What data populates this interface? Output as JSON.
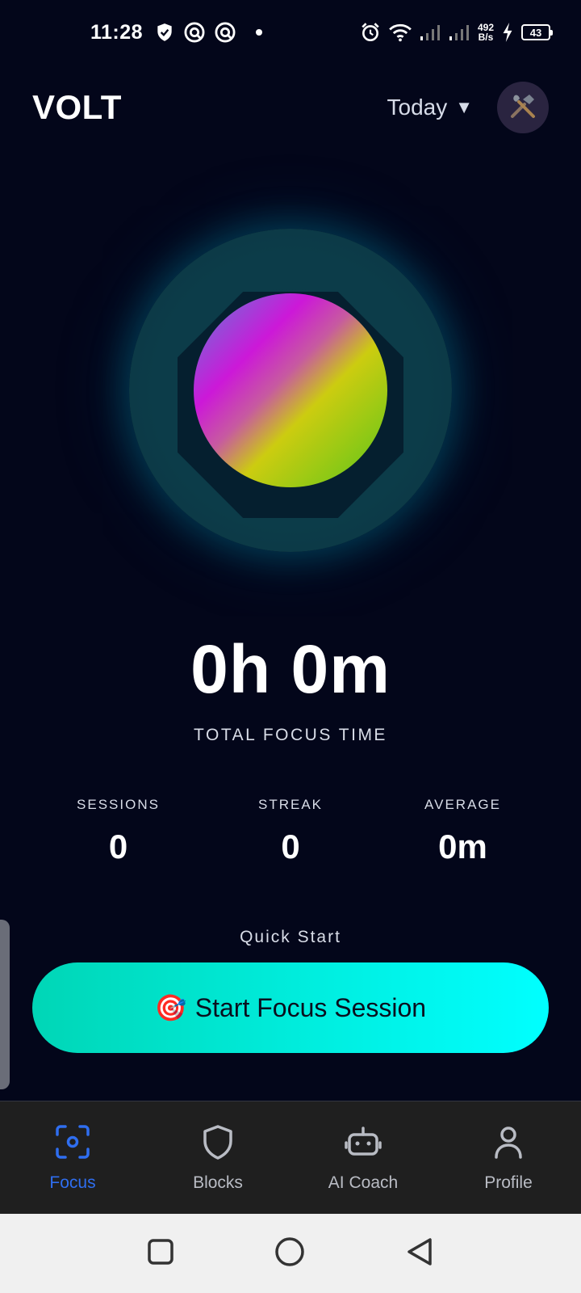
{
  "status_bar": {
    "time": "11:28",
    "net_speed_value": "492",
    "net_speed_unit": "B/s",
    "battery": "43",
    "icons": [
      "shield-check-icon",
      "vpn-icon",
      "vpn-icon",
      "dot-icon",
      "alarm-icon",
      "wifi-icon",
      "signal-icon",
      "signal-icon",
      "charging-icon",
      "battery-icon"
    ]
  },
  "header": {
    "title": "VOLT",
    "period": "Today",
    "period_caret": "▼",
    "settings_icon": "tools-icon"
  },
  "focus": {
    "total_time": "0h 0m",
    "total_label": "TOTAL FOCUS TIME"
  },
  "stats": [
    {
      "label": "SESSIONS",
      "value": "0"
    },
    {
      "label": "STREAK",
      "value": "0"
    },
    {
      "label": "AVERAGE",
      "value": "0m"
    }
  ],
  "quick_start": {
    "label": "Quick Start",
    "button_emoji": "🎯",
    "button_label": "Start Focus Session"
  },
  "bottom_nav": {
    "active": "Focus",
    "items": [
      {
        "label": "Focus",
        "icon": "focus-scan-icon"
      },
      {
        "label": "Blocks",
        "icon": "shield-icon"
      },
      {
        "label": "AI Coach",
        "icon": "robot-icon"
      },
      {
        "label": "Profile",
        "icon": "person-icon"
      }
    ]
  },
  "colors": {
    "background": "#03061a",
    "accent_cyan": "#00ffff",
    "accent_teal": "#00d6b6",
    "nav_active": "#2f6ef0",
    "nav_inactive": "#b9bcc4"
  }
}
